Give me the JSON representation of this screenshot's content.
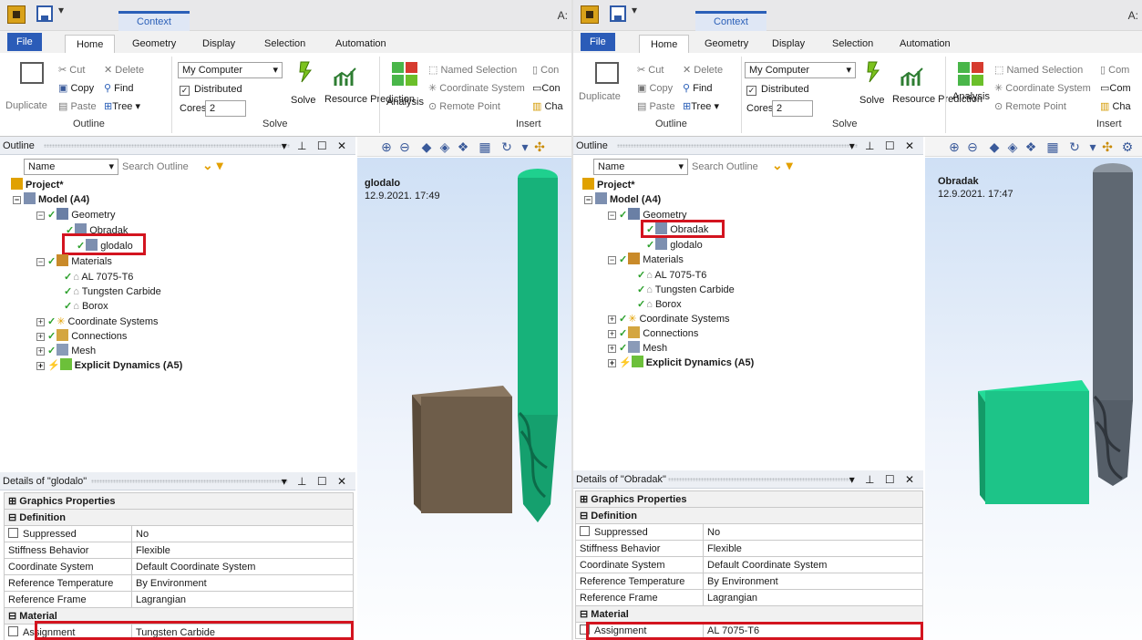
{
  "panes": [
    {
      "title_right": "A:",
      "context_tab": "Context",
      "tabs": [
        "File",
        "Home",
        "Geometry",
        "Display",
        "Selection",
        "Automation"
      ],
      "ribbon": {
        "duplicate": "Duplicate",
        "cut": "Cut",
        "copy": "Copy",
        "paste": "Paste",
        "delete": "Delete",
        "find": "Find",
        "tree": "Tree",
        "outline_group": "Outline",
        "solve_target": "My Computer",
        "distributed": "Distributed",
        "cores_label": "Cores",
        "cores_value": "2",
        "solve": "Solve",
        "resource_prediction": "Resource Prediction",
        "solve_group": "Solve",
        "analysis": "Analysis",
        "named_selection": "Named Selection",
        "coordinate_system": "Coordinate System",
        "remote_point": "Remote Point",
        "con1": "Con",
        "con2": "Con",
        "cha": "Cha",
        "insert_group": "Insert"
      },
      "outline": {
        "header": "Outline",
        "name_combo": "Name",
        "search_placeholder": "Search Outline",
        "tree": {
          "project": "Project*",
          "model": "Model (A4)",
          "geometry": "Geometry",
          "obradak": "Obradak",
          "glodalo": "glodalo",
          "materials": "Materials",
          "mat1": "AL 7075-T6",
          "mat2": "Tungsten Carbide",
          "mat3": "Borox",
          "coord": "Coordinate Systems",
          "connections": "Connections",
          "mesh": "Mesh",
          "explicit": "Explicit Dynamics (A5)"
        }
      },
      "details": {
        "header": "Details of \"glodalo\"",
        "graphics": "Graphics Properties",
        "definition": "Definition",
        "rows": [
          {
            "k": "Suppressed",
            "v": "No"
          },
          {
            "k": "Stiffness Behavior",
            "v": "Flexible"
          },
          {
            "k": "Coordinate System",
            "v": "Default Coordinate System"
          },
          {
            "k": "Reference Temperature",
            "v": "By Environment"
          },
          {
            "k": "Reference Frame",
            "v": "Lagrangian"
          }
        ],
        "material": "Material",
        "assignment_label": "Assignment",
        "assignment_value": "Tungsten Carbide"
      },
      "viewport": {
        "title": "glodalo",
        "date": "12.9.2021. 17:49"
      }
    },
    {
      "title_right": "A:",
      "context_tab": "Context",
      "tabs": [
        "File",
        "Home",
        "Geometry",
        "Display",
        "Selection",
        "Automation"
      ],
      "ribbon": {
        "duplicate": "Duplicate",
        "cut": "Cut",
        "copy": "Copy",
        "paste": "Paste",
        "delete": "Delete",
        "find": "Find",
        "tree": "Tree",
        "outline_group": "Outline",
        "solve_target": "My Computer",
        "distributed": "Distributed",
        "cores_label": "Cores",
        "cores_value": "2",
        "solve": "Solve",
        "resource_prediction": "Resource Prediction",
        "solve_group": "Solve",
        "analysis": "Analysis",
        "named_selection": "Named Selection",
        "coordinate_system": "Coordinate System",
        "remote_point": "Remote Point",
        "con1": "Com",
        "con2": "Com",
        "cha": "Cha",
        "insert_group": "Insert"
      },
      "outline": {
        "header": "Outline",
        "name_combo": "Name",
        "search_placeholder": "Search Outline",
        "tree": {
          "project": "Project*",
          "model": "Model (A4)",
          "geometry": "Geometry",
          "obradak": "Obradak",
          "glodalo": "glodalo",
          "materials": "Materials",
          "mat1": "AL 7075-T6",
          "mat2": "Tungsten Carbide",
          "mat3": "Borox",
          "coord": "Coordinate Systems",
          "connections": "Connections",
          "mesh": "Mesh",
          "explicit": "Explicit Dynamics (A5)"
        }
      },
      "details": {
        "header": "Details of \"Obradak\"",
        "graphics": "Graphics Properties",
        "definition": "Definition",
        "rows": [
          {
            "k": "Suppressed",
            "v": "No"
          },
          {
            "k": "Stiffness Behavior",
            "v": "Flexible"
          },
          {
            "k": "Coordinate System",
            "v": "Default Coordinate System"
          },
          {
            "k": "Reference Temperature",
            "v": "By Environment"
          },
          {
            "k": "Reference Frame",
            "v": "Lagrangian"
          }
        ],
        "material": "Material",
        "assignment_label": "Assignment",
        "assignment_value": "AL 7075-T6"
      },
      "viewport": {
        "title": "Obradak",
        "date": "12.9.2021. 17:47"
      }
    }
  ],
  "colors": {
    "tool_green": "#19b87a",
    "tool_gray": "#5f6872",
    "block_brown": "#6e5d4a",
    "block_green": "#1dc488",
    "highlight_red": "#d3141f",
    "file_blue": "#2b5cb8"
  }
}
